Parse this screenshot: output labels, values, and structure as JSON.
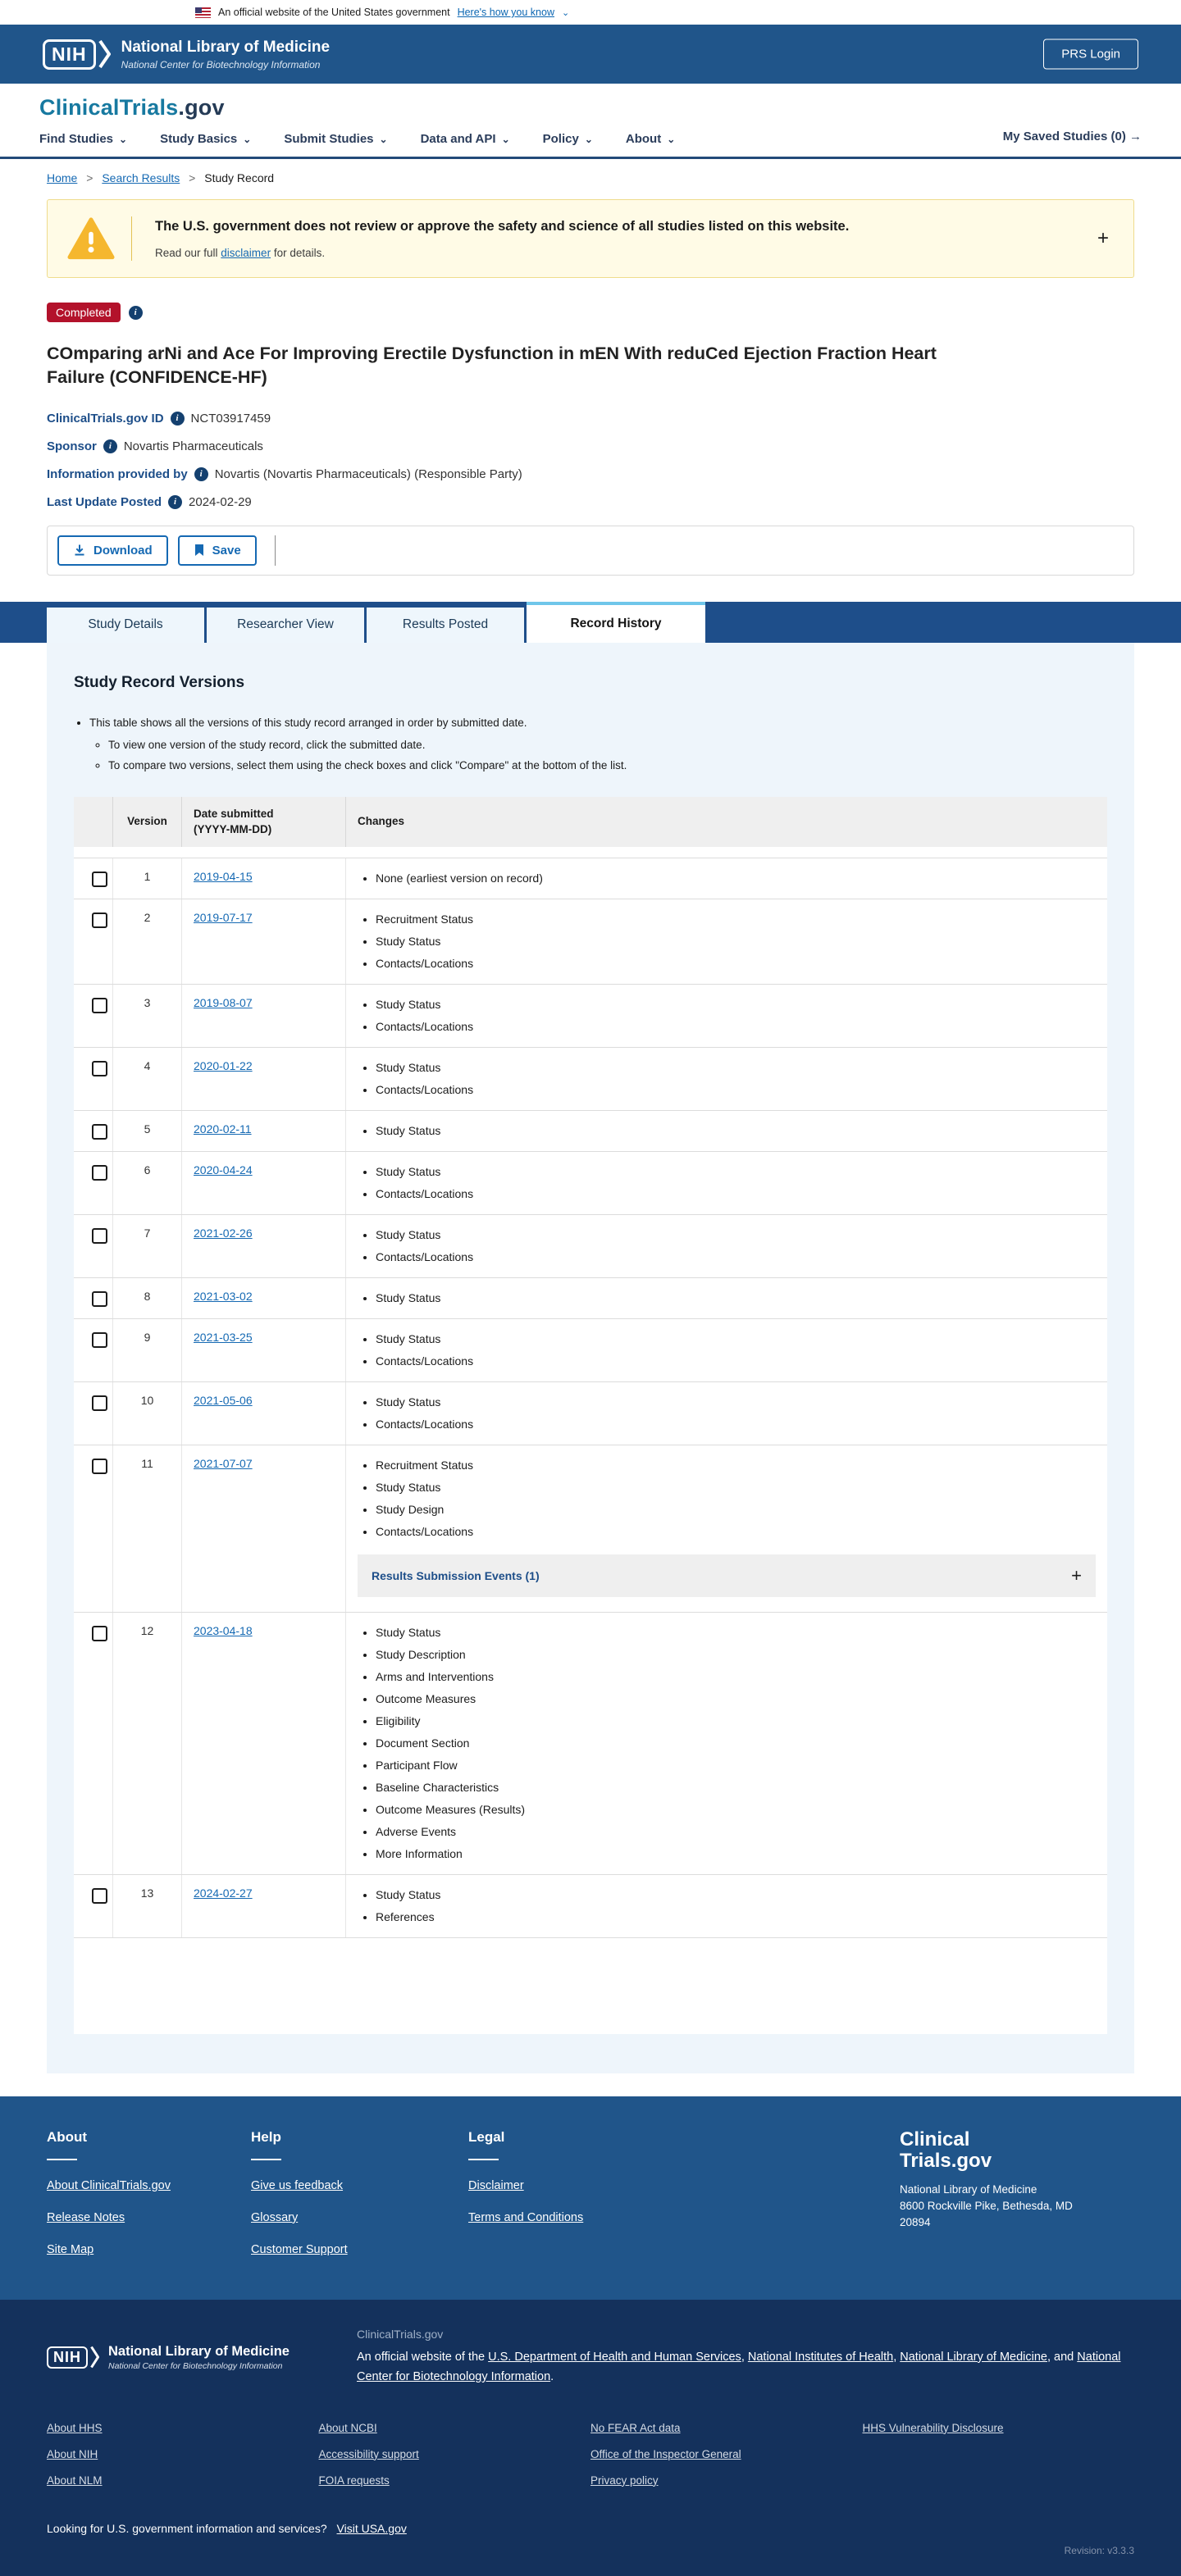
{
  "banner": {
    "text": "An official website of the United States government",
    "link": "Here's how you know",
    "chevron": "⌄"
  },
  "header": {
    "nih_abbr": "NIH",
    "org": "National Library of Medicine",
    "org_sub": "National Center for Biotechnology Information",
    "login_label": "PRS Login"
  },
  "nav": {
    "logo_main": "ClinicalTrials",
    "logo_tld": ".gov",
    "items": [
      "Find Studies",
      "Study Basics",
      "Submit Studies",
      "Data and API",
      "Policy",
      "About"
    ],
    "saved_label": "My Saved Studies (0)",
    "saved_arrow": "→"
  },
  "breadcrumb": {
    "home": "Home",
    "search": "Search Results",
    "current": "Study Record",
    "sep": ">"
  },
  "warning": {
    "title": "The U.S. government does not review or approve the safety and science of all studies listed on this website.",
    "body_prefix": "Read our full ",
    "link": "disclaimer",
    "body_suffix": " for details.",
    "expand": "+"
  },
  "study": {
    "status": "Completed",
    "info_glyph": "i",
    "title": "COmparing arNi and Ace For Improving Erectile Dysfunction in mEN With reduCed Ejection Fraction Heart Failure (CONFIDENCE-HF)",
    "fields": [
      {
        "label": "ClinicalTrials.gov ID",
        "value": "NCT03917459"
      },
      {
        "label": "Sponsor",
        "value": "Novartis Pharmaceuticals"
      },
      {
        "label": "Information provided by",
        "value": "Novartis (Novartis Pharmaceuticals) (Responsible Party)"
      },
      {
        "label": "Last Update Posted",
        "value": "2024-02-29"
      }
    ]
  },
  "actions": {
    "download": "Download",
    "save": "Save"
  },
  "tabs": [
    {
      "label": "Study Details"
    },
    {
      "label": "Researcher View"
    },
    {
      "label": "Results Posted"
    },
    {
      "label": "Record History"
    }
  ],
  "versions": {
    "heading": "Study Record Versions",
    "intro": "This table shows all the versions of this study record arranged in order by submitted date.",
    "intro_sub": [
      "To view one version of the study record, click the submitted date.",
      "To compare two versions, select them using the check boxes and click \"Compare\" at the bottom of the list."
    ],
    "headers": {
      "version": "Version",
      "date_l1": "Date submitted",
      "date_l2": "(YYYY-MM-DD)",
      "changes": "Changes"
    },
    "accordion": {
      "label": "Results Submission Events (1)",
      "expand": "+"
    },
    "rows": [
      {
        "version": "1",
        "date": "2019-04-15",
        "changes": [
          "None (earliest version on record)"
        ]
      },
      {
        "version": "2",
        "date": "2019-07-17",
        "changes": [
          "Recruitment Status",
          "Study Status",
          "Contacts/Locations"
        ]
      },
      {
        "version": "3",
        "date": "2019-08-07",
        "changes": [
          "Study Status",
          "Contacts/Locations"
        ]
      },
      {
        "version": "4",
        "date": "2020-01-22",
        "changes": [
          "Study Status",
          "Contacts/Locations"
        ]
      },
      {
        "version": "5",
        "date": "2020-02-11",
        "changes": [
          "Study Status"
        ]
      },
      {
        "version": "6",
        "date": "2020-04-24",
        "changes": [
          "Study Status",
          "Contacts/Locations"
        ]
      },
      {
        "version": "7",
        "date": "2021-02-26",
        "changes": [
          "Study Status",
          "Contacts/Locations"
        ]
      },
      {
        "version": "8",
        "date": "2021-03-02",
        "changes": [
          "Study Status"
        ]
      },
      {
        "version": "9",
        "date": "2021-03-25",
        "changes": [
          "Study Status",
          "Contacts/Locations"
        ]
      },
      {
        "version": "10",
        "date": "2021-05-06",
        "changes": [
          "Study Status",
          "Contacts/Locations"
        ]
      },
      {
        "version": "11",
        "date": "2021-07-07",
        "changes": [
          "Recruitment Status",
          "Study Status",
          "Study Design",
          "Contacts/Locations"
        ]
      },
      {
        "version": "12",
        "date": "2023-04-18",
        "changes": [
          "Study Status",
          "Study Description",
          "Arms and Interventions",
          "Outcome Measures",
          "Eligibility",
          "Document Section",
          "Participant Flow",
          "Baseline Characteristics",
          "Outcome Measures (Results)",
          "Adverse Events",
          "More Information"
        ]
      },
      {
        "version": "13",
        "date": "2024-02-27",
        "changes": [
          "Study Status",
          "References"
        ]
      }
    ]
  },
  "footer": {
    "columns": [
      {
        "heading": "About",
        "links": [
          "About ClinicalTrials.gov",
          "Release Notes",
          "Site Map"
        ]
      },
      {
        "heading": "Help",
        "links": [
          "Give us feedback",
          "Glossary",
          "Customer Support"
        ]
      },
      {
        "heading": "Legal",
        "links": [
          "Disclaimer",
          "Terms and Conditions"
        ]
      }
    ],
    "brand_line1": "Clinical",
    "brand_line2": "Trials.gov",
    "address": [
      "National Library of Medicine",
      "8600 Rockville Pike, Bethesda, MD",
      "20894"
    ]
  },
  "subfooter": {
    "nih_abbr": "NIH",
    "org": "National Library of Medicine",
    "org_sub": "National Center for Biotechnology Information",
    "site": "ClinicalTrials.gov",
    "desc_prefix": "An official website of the ",
    "desc_links": [
      "U.S. Department of Health and Human Services",
      "National Institutes of Health",
      "National Library of Medicine",
      "National Center for Biotechnology Information"
    ],
    "sep_comma": ", ",
    "sep_and": ", and ",
    "period": ".",
    "link_columns": [
      [
        "About HHS",
        "About NIH",
        "About NLM"
      ],
      [
        "About NCBI",
        "Accessibility support",
        "FOIA requests"
      ],
      [
        "No FEAR Act data",
        "Office of the Inspector General",
        "Privacy policy"
      ],
      [
        "HHS Vulnerability Disclosure"
      ]
    ],
    "usa_text": "Looking for U.S. government information and services?",
    "usa_link": "Visit USA.gov",
    "revision": "Revision: v3.3.3"
  },
  "colors": {
    "header_blue": "#20558a",
    "tab_blue": "#1e4e8a",
    "subfooter_navy": "#14315c",
    "link_blue": "#1569b3",
    "badge_red": "#b3122b",
    "panel_blue": "#eef5fb",
    "warning_yellow": "#fffbe6",
    "accent_cyan": "#6fc6ea"
  }
}
